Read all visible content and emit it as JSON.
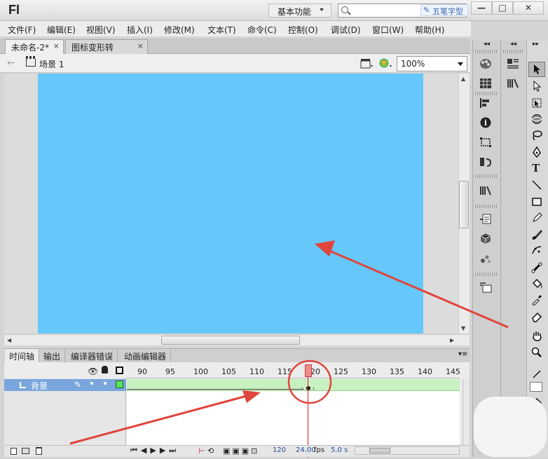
{
  "app": {
    "logo": "Fl",
    "workspace": "基本功能",
    "search_placeholder": "",
    "watermark": "五笔字型",
    "window_buttons": [
      "—",
      "□",
      "✕"
    ]
  },
  "menu": [
    "文件(F)",
    "编辑(E)",
    "视图(V)",
    "插入(I)",
    "修改(M)",
    "文本(T)",
    "命令(C)",
    "控制(O)",
    "调试(D)",
    "窗口(W)",
    "帮助(H)"
  ],
  "doc_tabs": [
    {
      "label": "未命名-2*",
      "close": "×"
    },
    {
      "label": "图标变形转换.fla",
      "close": "×"
    }
  ],
  "editbar": {
    "scene_label": "场景 1",
    "zoom": "100%"
  },
  "timeline": {
    "tabs": [
      "时间轴",
      "输出",
      "编译器错误",
      "动画编辑器"
    ],
    "ruler_ticks": [
      "90",
      "95",
      "100",
      "105",
      "110",
      "115",
      "120",
      "125",
      "130",
      "135",
      "140",
      "145"
    ],
    "layer_name": "背景",
    "current_frame": "120",
    "fps": "24.00",
    "fps_unit": "fps",
    "elapsed": "5.0 s"
  },
  "colors": {
    "stage": "#66c8fa",
    "layer_selected": "#7aa6dd",
    "frames": "#c8f1c0",
    "playhead": "#d42222",
    "annotation": "#e0443c",
    "fill_swatch": "#cf9c97"
  },
  "tools_icons": [
    "selection-icon",
    "subselection-icon",
    "free-transform-icon",
    "3d-rotation-icon",
    "lasso-icon",
    "pen-icon",
    "text-icon",
    "line-icon",
    "rectangle-icon",
    "pencil-icon",
    "brush-icon",
    "deco-icon",
    "bone-icon",
    "paint-bucket-icon",
    "eyedropper-icon",
    "eraser-icon",
    "hand-icon",
    "zoom-icon"
  ],
  "panel_icons": [
    "color-icon",
    "swatches-icon",
    "align-icon",
    "info-icon",
    "transform-icon",
    "motion-presets-icon",
    "library-icon",
    "code-snippets-icon",
    "components-icon",
    "component-inspector-icon",
    "scene-icon"
  ]
}
